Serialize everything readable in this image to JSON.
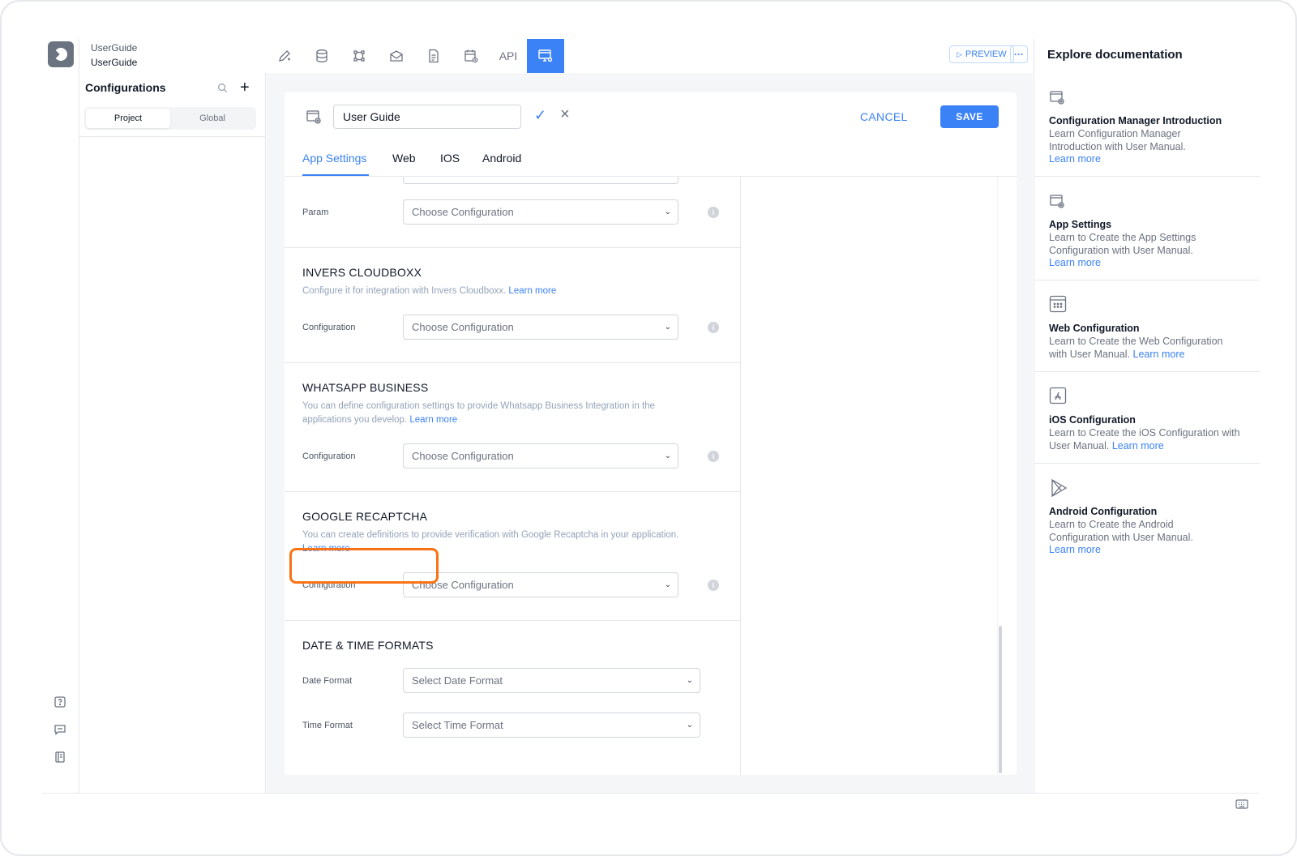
{
  "project": {
    "workspace": "UserGuide",
    "name": "UserGuide"
  },
  "sidebar": {
    "title": "Configurations",
    "segments": [
      "Project",
      "Global"
    ],
    "active_segment": "Project",
    "icons": [
      "search-icon",
      "plus-icon"
    ],
    "rail_icons": [
      "help-icon",
      "chat-icon",
      "book-icon"
    ]
  },
  "toolbar": {
    "icons": [
      "edit-icon",
      "database-icon",
      "flow-icon",
      "mail-icon",
      "document-icon",
      "calendar-icon",
      "api-label",
      "config-icon"
    ],
    "api_label": "API",
    "preview_label": "PREVIEW",
    "more_label": "···"
  },
  "editor": {
    "name_value": "User Guide",
    "cancel_label": "CANCEL",
    "save_label": "SAVE",
    "tabs": [
      "App Settings",
      "Web",
      "IOS",
      "Android"
    ],
    "active_tab": "App Settings",
    "sections": {
      "param": {
        "label": "Param",
        "select": "Choose Configuration"
      },
      "invers": {
        "title": "INVERS CLOUDBOXX",
        "desc": "Configure it for integration with Invers Cloudboxx.",
        "link": "Learn more",
        "label": "Configuration",
        "select": "Choose Configuration"
      },
      "whatsapp": {
        "title": "WHATSAPP BUSINESS",
        "desc": "You can define configuration settings to provide Whatsapp Business Integration in the applications you develop.",
        "link": "Learn more",
        "label": "Configuration",
        "select": "Choose Configuration"
      },
      "recaptcha": {
        "title": "GOOGLE RECAPTCHA",
        "desc": "You can create definitions to provide verification with Google Recaptcha in your application.",
        "link": "Learn more",
        "label": "Configuration",
        "select": "Choose Configuration"
      },
      "datetime": {
        "title": "DATE & TIME FORMATS",
        "date_label": "Date Format",
        "date_select": "Select Date Format",
        "time_label": "Time Format",
        "time_select": "Select Time Format"
      }
    },
    "accent_color": "#3b82f6",
    "highlight_color": "#f97316"
  },
  "docs": {
    "title": "Explore documentation",
    "items": [
      {
        "icon": "config-icon",
        "title": "Configuration Manager Introduction",
        "desc": "Learn Configuration Manager Introduction with User Manual.",
        "link": "Learn more"
      },
      {
        "icon": "config-icon",
        "title": "App Settings",
        "desc": "Learn to Create the App Settings Configuration with User Manual.",
        "link": "Learn more"
      },
      {
        "icon": "web-icon",
        "title": "Web Configuration",
        "desc": "Learn to Create the Web Configuration with User Manual.",
        "link": "Learn more"
      },
      {
        "icon": "app-store-icon",
        "title": "iOS Configuration",
        "desc": "Learn to Create the iOS Configuration with User Manual.",
        "link": "Learn more"
      },
      {
        "icon": "play-store-icon",
        "title": "Android Configuration",
        "desc": "Learn to Create the Android Configuration with User Manual.",
        "link": "Learn more"
      }
    ]
  }
}
